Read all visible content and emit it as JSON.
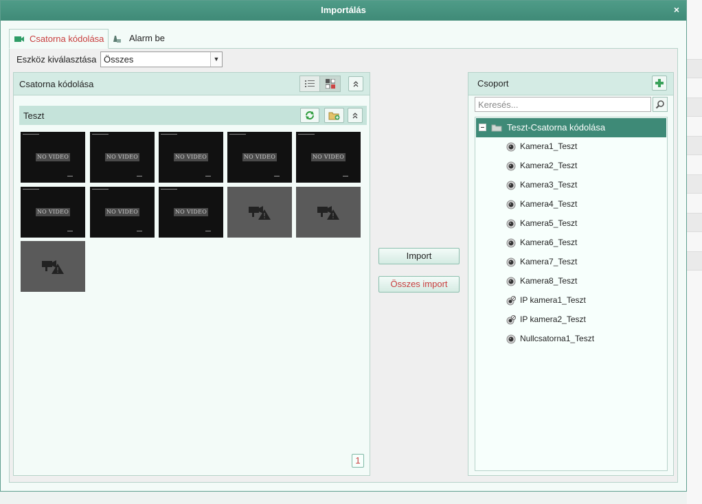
{
  "dialog": {
    "title": "Importálás",
    "close_label": "×"
  },
  "tabs": [
    {
      "label": "Csatorna kódolása",
      "active": true,
      "icon": "video-camera-icon"
    },
    {
      "label": "Alarm be",
      "active": false,
      "icon": "alarm-input-icon"
    }
  ],
  "device_filter": {
    "label": "Eszköz kiválasztása",
    "value": "Összes"
  },
  "left_panel": {
    "title": "Csatorna kódolása",
    "group": {
      "title": "Teszt"
    },
    "thumbnails": [
      {
        "type": "no-video",
        "text": "NO VIDEO"
      },
      {
        "type": "no-video",
        "text": "NO VIDEO"
      },
      {
        "type": "no-video",
        "text": "NO VIDEO"
      },
      {
        "type": "no-video",
        "text": "NO VIDEO"
      },
      {
        "type": "no-video",
        "text": "NO VIDEO"
      },
      {
        "type": "no-video",
        "text": "NO VIDEO"
      },
      {
        "type": "no-video",
        "text": "NO VIDEO"
      },
      {
        "type": "no-video",
        "text": "NO VIDEO"
      },
      {
        "type": "offline",
        "icon": "camera-warning-icon"
      },
      {
        "type": "offline",
        "icon": "camera-warning-icon"
      },
      {
        "type": "offline",
        "icon": "camera-warning-icon"
      }
    ],
    "page": "1"
  },
  "actions": {
    "import_label": "Import",
    "import_all_label": "Összes import"
  },
  "right_panel": {
    "title": "Csoport",
    "search_placeholder": "Keresés...",
    "tree": {
      "root_label": "Teszt-Csatorna kódolása",
      "items": [
        {
          "label": "Kamera1_Teszt",
          "icon": "camera-icon"
        },
        {
          "label": "Kamera2_Teszt",
          "icon": "camera-icon"
        },
        {
          "label": "Kamera3_Teszt",
          "icon": "camera-icon"
        },
        {
          "label": "Kamera4_Teszt",
          "icon": "camera-icon"
        },
        {
          "label": "Kamera5_Teszt",
          "icon": "camera-icon"
        },
        {
          "label": "Kamera6_Teszt",
          "icon": "camera-icon"
        },
        {
          "label": "Kamera7_Teszt",
          "icon": "camera-icon"
        },
        {
          "label": "Kamera8_Teszt",
          "icon": "camera-icon"
        },
        {
          "label": "IP kamera1_Teszt",
          "icon": "ip-camera-icon"
        },
        {
          "label": "IP kamera2_Teszt",
          "icon": "ip-camera-icon"
        },
        {
          "label": "Nullcsatorna1_Teszt",
          "icon": "camera-icon"
        }
      ]
    }
  },
  "colors": {
    "title_bar": "#3f8a77",
    "accent_red": "#c83d3d",
    "panel_header": "#d4ebe4",
    "selected_row": "#3e8a77"
  }
}
